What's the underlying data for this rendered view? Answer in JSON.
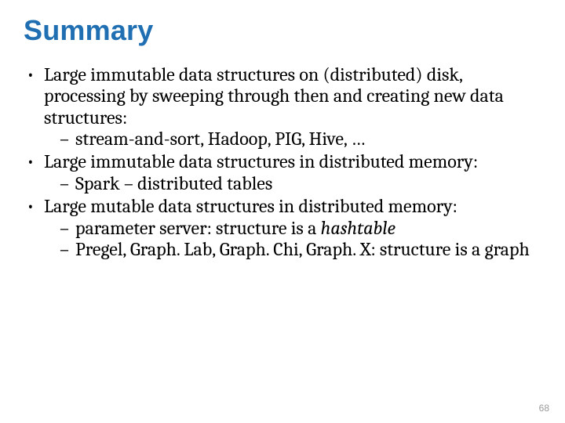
{
  "title": "Summary",
  "bullets": [
    {
      "text": "Large immutable data structures on (distributed) disk, processing by sweeping through then and creating new data structures:",
      "sub": [
        {
          "text": "stream-and-sort, Hadoop, PIG, Hive, …"
        }
      ]
    },
    {
      "text": "Large immutable data structures in distributed memory:",
      "sub": [
        {
          "text": "Spark – distributed tables"
        }
      ]
    },
    {
      "text": "Large mutable data structures in distributed memory:",
      "sub": [
        {
          "prefix": "parameter server: structure is a ",
          "ital": "hashtable"
        },
        {
          "text": "Pregel, Graph. Lab, Graph. Chi, Graph. X: structure is a graph"
        }
      ]
    }
  ],
  "page_number": "68"
}
